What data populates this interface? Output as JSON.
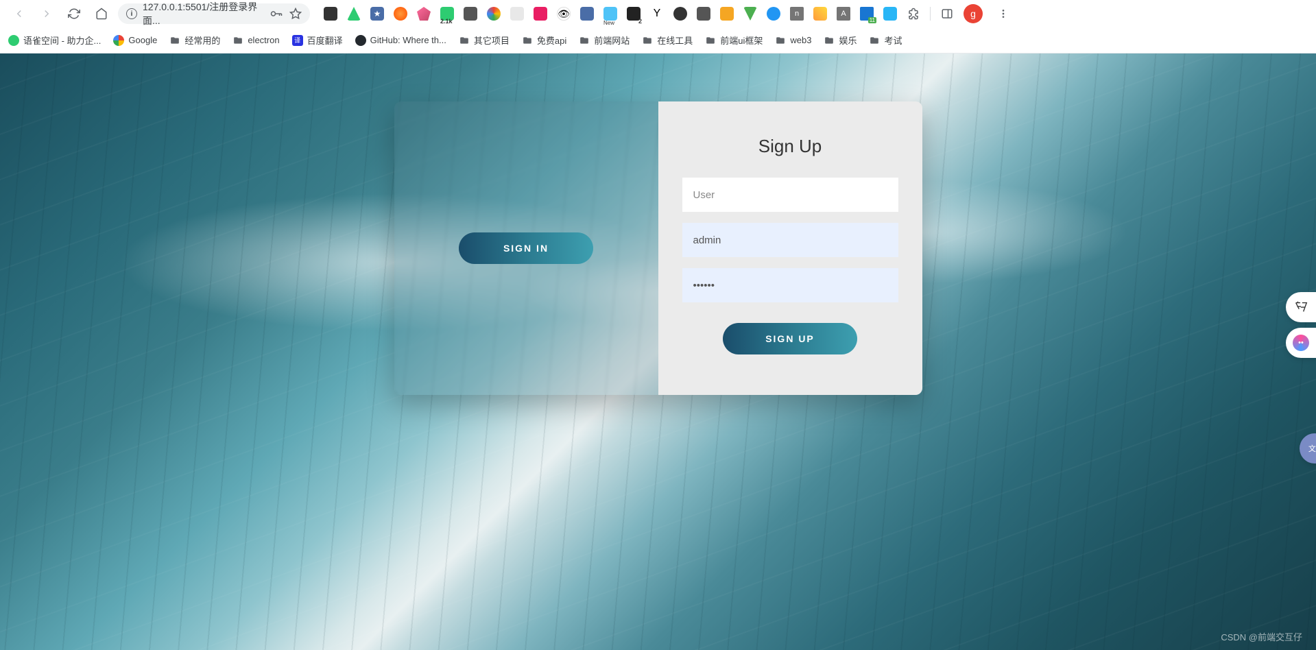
{
  "browser": {
    "url": "127.0.0.1:5501/注册登录界面...",
    "avatar_letter": "g"
  },
  "bookmarks": [
    {
      "label": "语雀空间 - 助力企...",
      "type": "yuque"
    },
    {
      "label": "Google",
      "type": "google"
    },
    {
      "label": "经常用的",
      "type": "folder"
    },
    {
      "label": "electron",
      "type": "folder"
    },
    {
      "label": "百度翻译",
      "type": "baidu"
    },
    {
      "label": "GitHub: Where th...",
      "type": "github"
    },
    {
      "label": "其它项目",
      "type": "folder"
    },
    {
      "label": "免费api",
      "type": "folder"
    },
    {
      "label": "前端网站",
      "type": "folder"
    },
    {
      "label": "在线工具",
      "type": "folder"
    },
    {
      "label": "前端ui框架",
      "type": "folder"
    },
    {
      "label": "web3",
      "type": "folder"
    },
    {
      "label": "娱乐",
      "type": "folder"
    },
    {
      "label": "考试",
      "type": "folder"
    }
  ],
  "auth": {
    "signin_button": "SIGN IN",
    "signup_title": "Sign Up",
    "user_placeholder": "User",
    "username_value": "admin",
    "password_value": "••••••",
    "signup_button": "SIGN UP"
  },
  "watermark": "CSDN @前端交互仔"
}
